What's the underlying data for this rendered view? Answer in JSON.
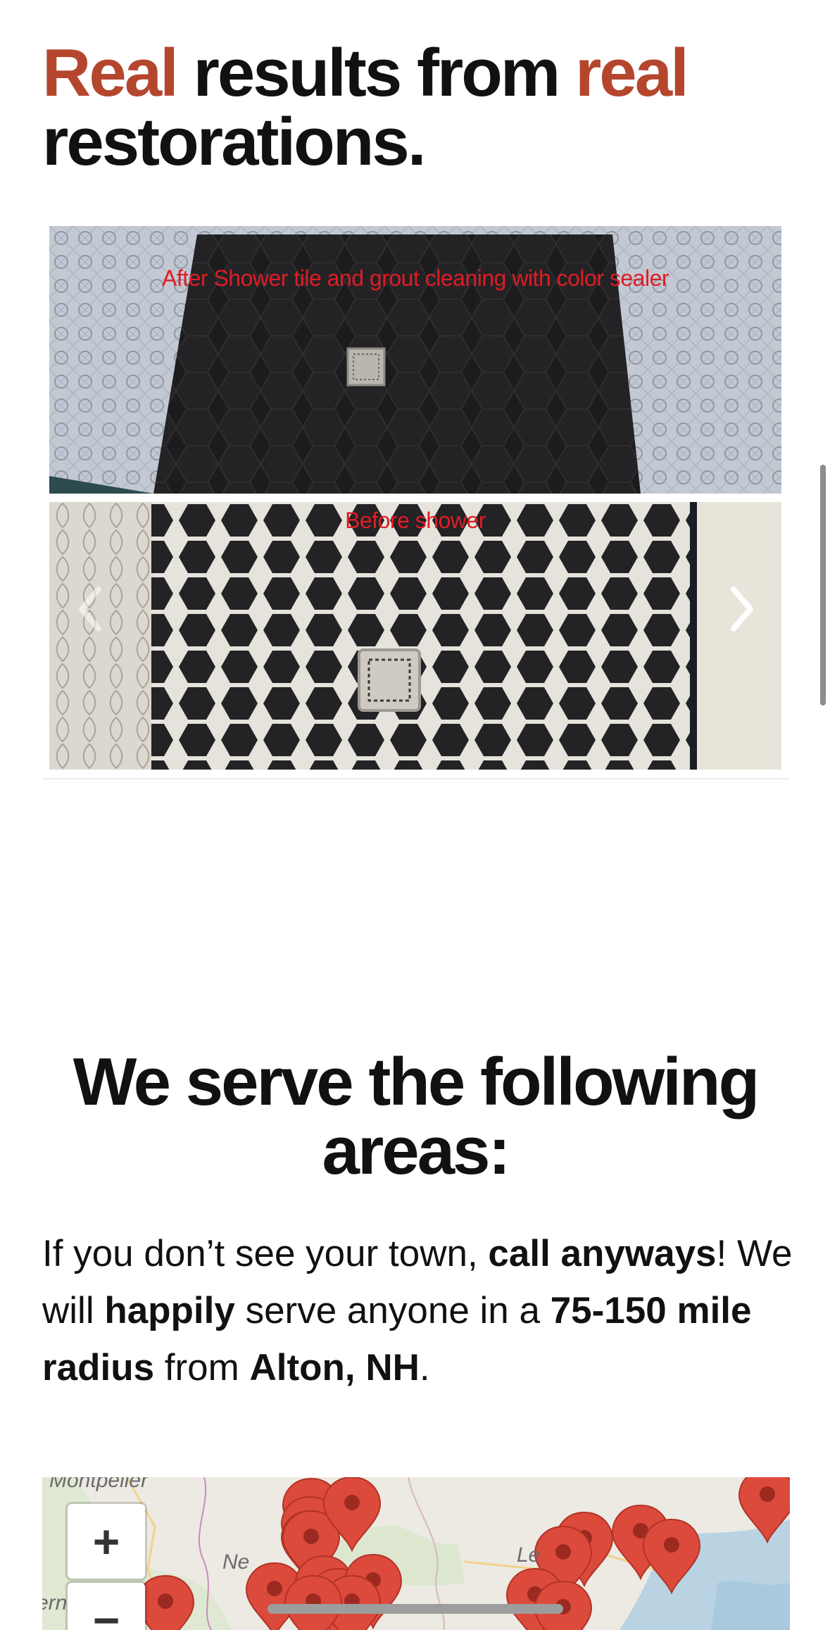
{
  "results_section": {
    "heading_parts": [
      "Real",
      " results from ",
      "real",
      " restorations."
    ]
  },
  "gallery": {
    "after_caption": "After Shower tile and grout cleaning with color sealer",
    "before_caption": "Before  shower",
    "prev_icon": "chevron-left-icon",
    "next_icon": "chevron-right-icon"
  },
  "areas_section": {
    "heading": "We serve the following areas:",
    "text_parts": [
      "If you don’t see your town, ",
      "call anyways",
      "! We will ",
      "happily",
      " serve anyone in a ",
      "75-150 mile radius",
      " from ",
      "Alton, NH",
      "."
    ]
  },
  "map": {
    "labels": [
      "Montpelier",
      "Ne",
      "Le",
      "ern"
    ],
    "zoom_in": "+",
    "zoom_out": "−",
    "marker_color": "#dc4a3c"
  },
  "colors": {
    "accent": "#b5462e",
    "caption": "#e01c24"
  }
}
